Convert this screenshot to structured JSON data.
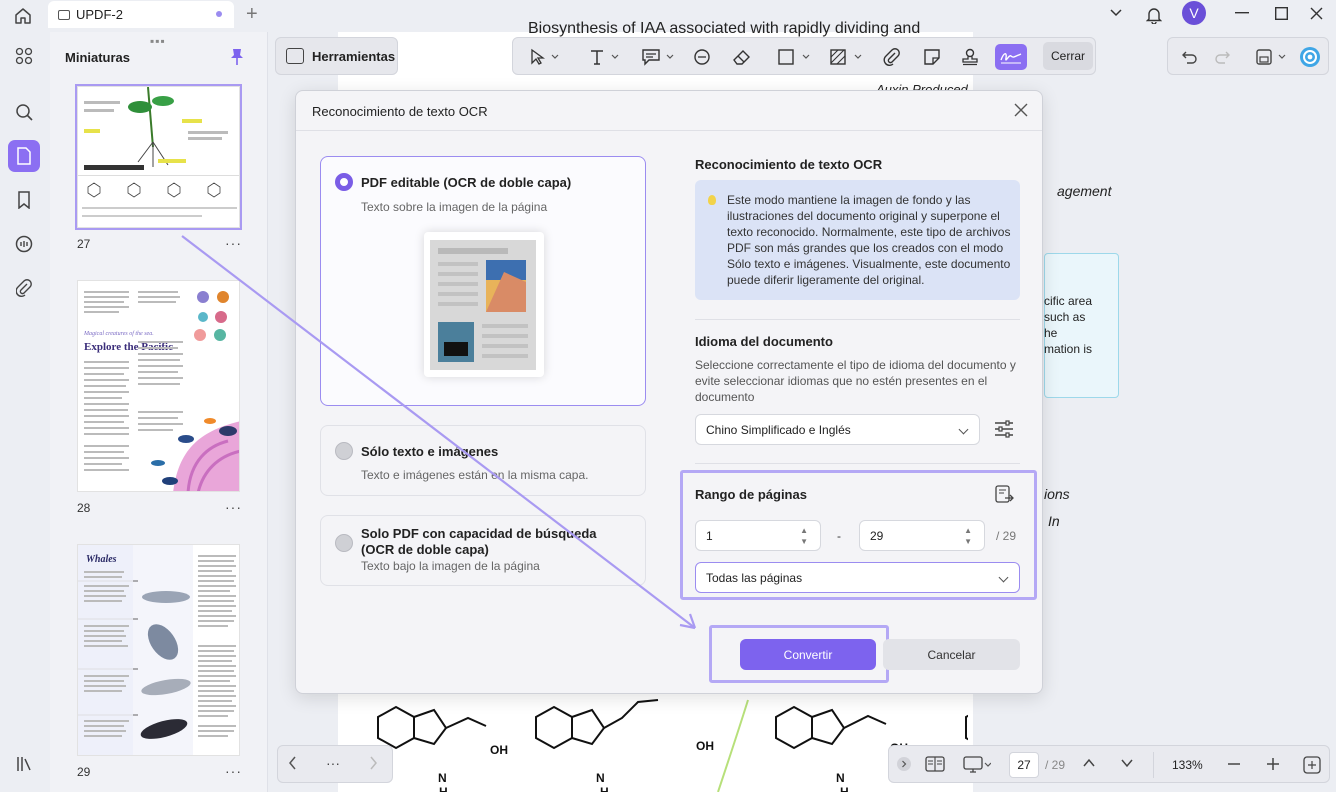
{
  "titlebar": {
    "tab_title": "UPDF-2",
    "avatar_letter": "V"
  },
  "thumbnails": {
    "title": "Miniaturas",
    "pages": [
      {
        "number": "27",
        "heading": "STRUCTURE OF AUXIN"
      },
      {
        "number": "28",
        "heading": "Explore the Pacific",
        "kicker": "Magical creatures of the sea."
      },
      {
        "number": "29",
        "heading": "Whales"
      }
    ]
  },
  "toolbar": {
    "tools_label": "Herramientas",
    "close_label": "Cerrar"
  },
  "document": {
    "title_fragment": "Biosynthesis of IAA associated with rapidly dividing and",
    "snippet_1": "Auxin Produced In",
    "snippet_2": "agement",
    "snippet_3": "cific area",
    "snippet_4": "such as",
    "snippet_5": "he",
    "snippet_6": "mation is",
    "snippet_7": "ions",
    "snippet_8": "In",
    "chem_labels": [
      "OH",
      "OH",
      "OH",
      "OH"
    ],
    "nh_label": "H",
    "n_label": "N"
  },
  "modal": {
    "title": "Reconocimiento de texto OCR",
    "options": [
      {
        "title": "PDF editable (OCR de doble capa)",
        "subtitle": "Texto sobre la imagen de la página",
        "selected": true
      },
      {
        "title": "Sólo texto e imágenes",
        "subtitle": "Texto e imágenes están en la misma capa.",
        "selected": false
      },
      {
        "title": "Solo PDF con capacidad de búsqueda (OCR de doble capa)",
        "subtitle": "Texto bajo la imagen de la página",
        "selected": false
      }
    ],
    "ocr_heading": "Reconocimiento de texto OCR",
    "info_text": "Este modo mantiene la imagen de fondo y las ilustraciones del documento original y superpone el texto reconocido. Normalmente, este tipo de archivos PDF son más grandes que los creados con el modo Sólo texto e imágenes. Visualmente, este documento puede diferir ligeramente del original.",
    "language_heading": "Idioma del documento",
    "language_desc": "Seleccione correctamente el tipo de idioma del documento y evite seleccionar idiomas que no estén presentes en el documento",
    "language_value": "Chino Simplificado e Inglés",
    "range_heading": "Rango de páginas",
    "range_from": "1",
    "range_sep": "-",
    "range_to": "29",
    "range_total": "/ 29",
    "range_select": "Todas las páginas",
    "convert_label": "Convertir",
    "cancel_label": "Cancelar"
  },
  "bottom": {
    "nav_more": "···",
    "current_page": "27",
    "total_pages": "/ 29",
    "zoom": "133%"
  },
  "colors": {
    "accent": "#7d63ee",
    "highlight_border": "#b4a8f5",
    "info_bg": "#dbe3f6"
  }
}
